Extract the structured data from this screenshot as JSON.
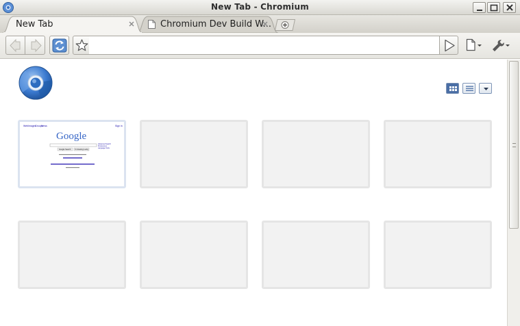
{
  "window": {
    "title": "New Tab - Chromium",
    "controls": [
      "minimize",
      "maximize",
      "close"
    ]
  },
  "tabs": [
    {
      "label": "New Tab",
      "active": true
    },
    {
      "label": "Chromium Dev Build W...",
      "active": false
    }
  ],
  "toolbar": {
    "omnibox_value": "",
    "buttons": [
      "back-icon",
      "forward-icon",
      "reload-icon",
      "star-icon",
      "go-icon",
      "page-menu-icon",
      "wrench-icon"
    ]
  },
  "ntp": {
    "view_modes": [
      "thumbnails",
      "list",
      "menu"
    ],
    "active_view": "thumbnails",
    "thumbnails": [
      {
        "filled": true,
        "preview": {
          "brand": "Google",
          "top_links": [
            "Web",
            "Images",
            "Groups",
            "News"
          ],
          "signin": "Sign in",
          "search_button": "Google Search",
          "lucky_button": "I'm Feeling Lucky",
          "side_links": [
            "Advanced Search",
            "Preferences",
            "Language Tools"
          ]
        }
      },
      {
        "filled": false
      },
      {
        "filled": false
      },
      {
        "filled": false
      },
      {
        "filled": false
      },
      {
        "filled": false
      },
      {
        "filled": false
      },
      {
        "filled": false
      }
    ]
  },
  "colors": {
    "title_bar": "#d9d8d2",
    "accent_blue": "#4a6ea5",
    "empty_thumbnail": "#f2f2f2"
  }
}
